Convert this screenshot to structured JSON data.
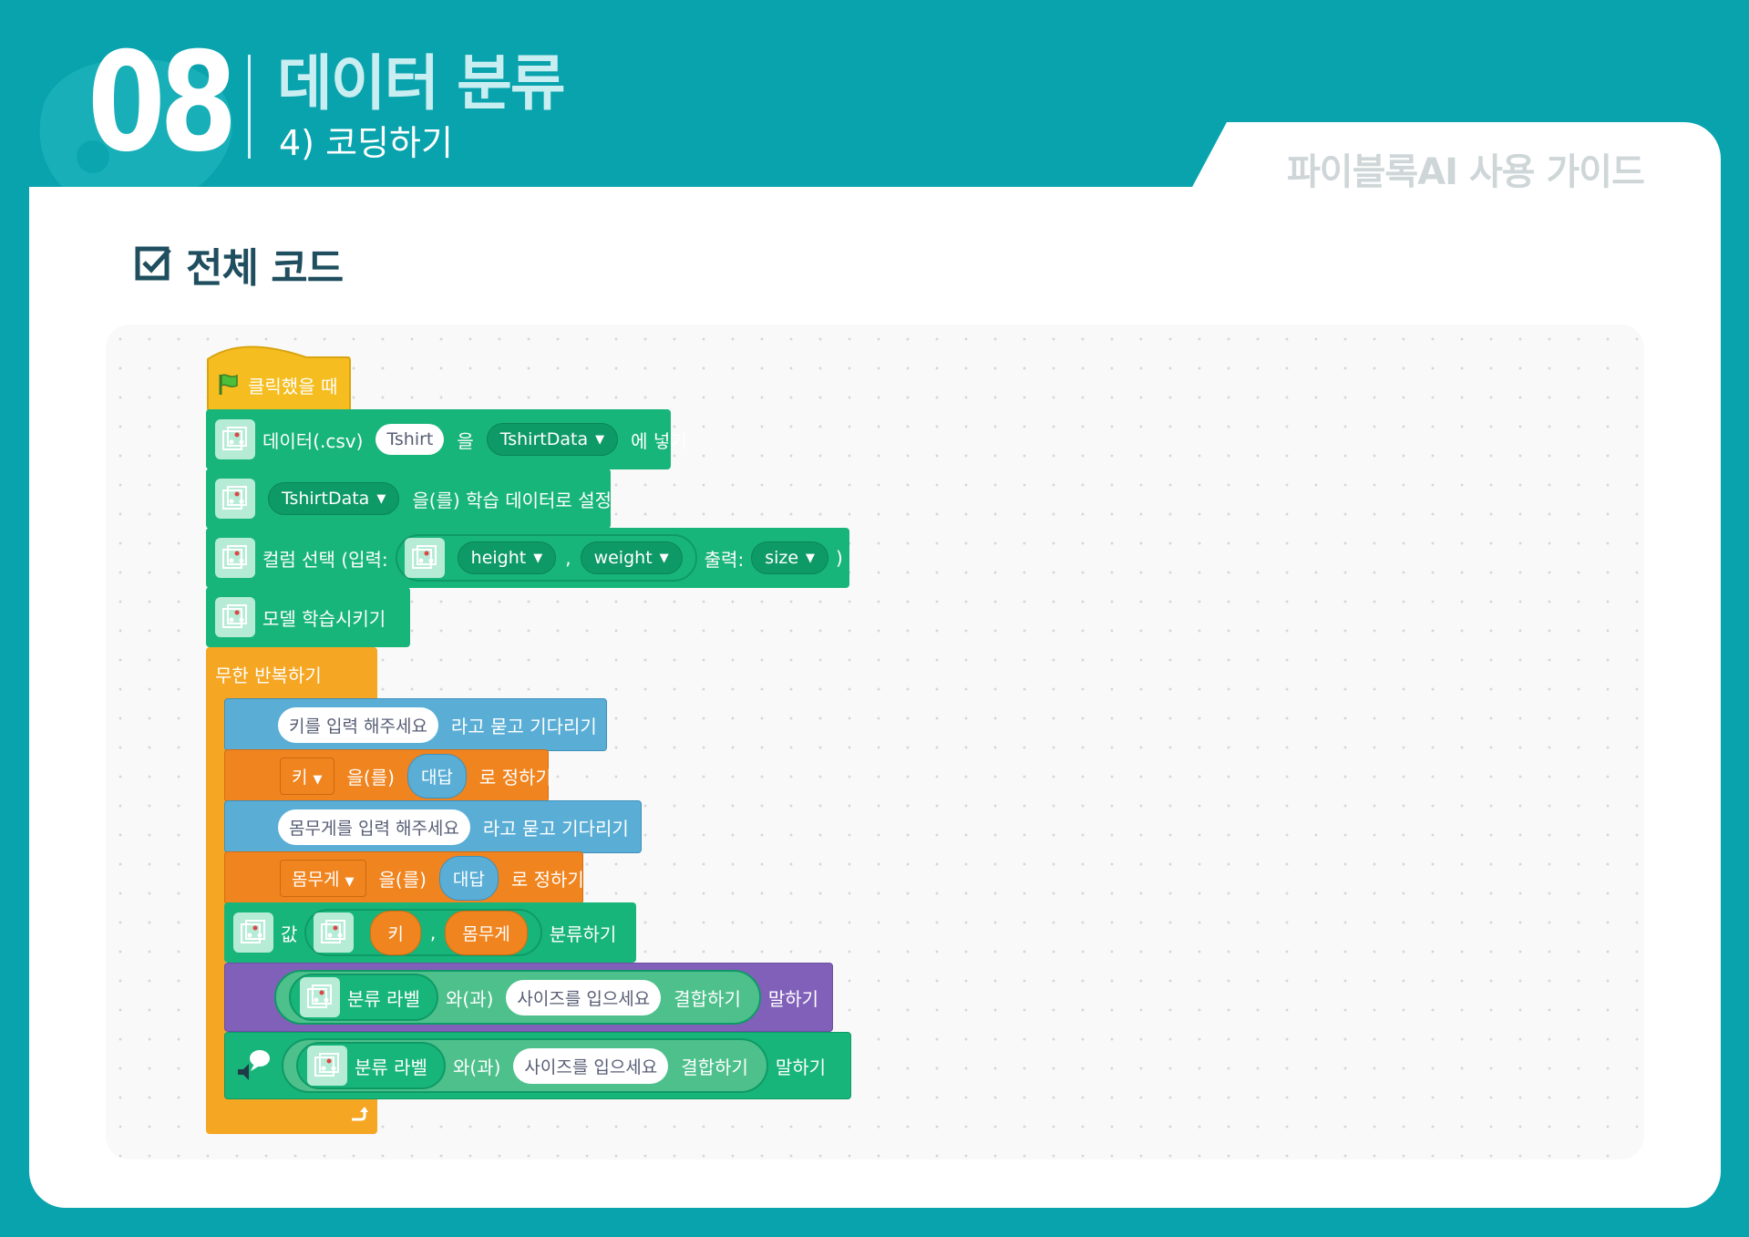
{
  "header": {
    "chapter_number": "08",
    "chapter_title": "데이터 분류",
    "chapter_subtitle": "4) 코딩하기",
    "guide_label": "파이블록AI 사용 가이드"
  },
  "section": {
    "title": "전체 코드"
  },
  "colors": {
    "background": "#08a3ad",
    "events": "#f5bd1f",
    "extension": "#18b57a",
    "control": "#f5a623",
    "sensing": "#5aaed6",
    "variables": "#f0841f",
    "looks": "#8060b8"
  },
  "blocks": {
    "hat": {
      "label": "클릭했을 때",
      "icon": "green-flag-icon"
    },
    "load_data": {
      "prefix": "데이터(.csv)",
      "file_value": "Tshirt",
      "mid": "을",
      "dataset_dropdown": "TshirtData",
      "suffix": "에 넣기"
    },
    "set_training": {
      "dataset_dropdown": "TshirtData",
      "suffix": "을(를) 학습 데이터로 설정"
    },
    "select_columns": {
      "prefix": "컬럼 선택 (입력:",
      "input1": "height",
      "comma": ",",
      "input2": "weight",
      "output_label": "출력:",
      "output": "size",
      "close": ")"
    },
    "train_model": {
      "label": "모델 학습시키기"
    },
    "forever": {
      "label": "무한 반복하기"
    },
    "ask_height": {
      "question": "키를 입력 해주세요",
      "suffix": "라고 묻고 기다리기"
    },
    "set_height": {
      "variable": "키",
      "mid": "을(를)",
      "answer": "대답",
      "suffix": "로 정하기"
    },
    "ask_weight": {
      "question": "몸무게를 입력 해주세요",
      "suffix": "라고 묻고 기다리기"
    },
    "set_weight": {
      "variable": "몸무게",
      "mid": "을(를)",
      "answer": "대답",
      "suffix": "로 정하기"
    },
    "classify": {
      "prefix": "값",
      "var1": "키",
      "comma": ",",
      "var2": "몸무게",
      "suffix": "분류하기"
    },
    "say_looks": {
      "label": "분류 라벨",
      "join_mid": "와(과)",
      "text": "사이즈를 입으세요",
      "join_suffix": "결합하기",
      "suffix": "말하기"
    },
    "say_tts": {
      "label": "분류 라벨",
      "join_mid": "와(과)",
      "text": "사이즈를 입으세요",
      "join_suffix": "결합하기",
      "suffix": "말하기"
    }
  }
}
